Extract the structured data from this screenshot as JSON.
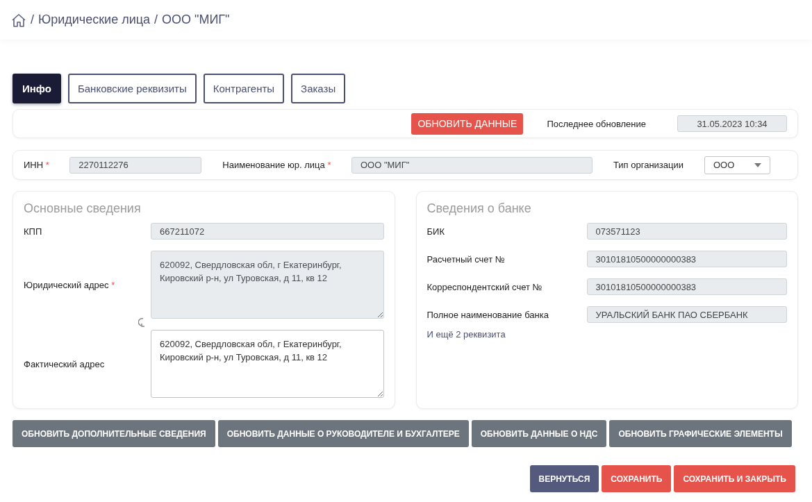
{
  "breadcrumb": {
    "separator": "/",
    "items": [
      "Юридические лица",
      "ООО \"МИГ\""
    ]
  },
  "required_mark": "*",
  "tabs": [
    {
      "label": "Инфо",
      "selected": true
    },
    {
      "label": "Банковские реквизиты",
      "selected": false
    },
    {
      "label": "Контрагенты",
      "selected": false
    },
    {
      "label": "Заказы",
      "selected": false
    }
  ],
  "update_bar": {
    "button": "ОБНОВИТЬ ДАННЫЕ",
    "label": "Последнее обновление",
    "value": "31.05.2023 10:34"
  },
  "org_row": [
    {
      "kind": "input",
      "label": "ИНН",
      "required": true,
      "value": "2270112276"
    },
    {
      "kind": "input",
      "label": "Наименование юр. лица",
      "required": true,
      "value": "ООО \"МИГ\""
    },
    {
      "kind": "select",
      "label": "Тип организации",
      "required": false,
      "value": "ООО"
    }
  ],
  "main_info": {
    "title": "Основные сведения",
    "fields": [
      {
        "kind": "input",
        "label": "КПП",
        "required": false,
        "disabled": true,
        "value": "667211072"
      },
      {
        "kind": "textarea",
        "label": "Юридический адрес",
        "required": true,
        "disabled": true,
        "value": "620092, Свердловская обл, г Екатеринбург, Кировский р-н, ул Туровская, д 11, кв 12"
      },
      {
        "kind": "textarea",
        "label": "Фактический адрес",
        "required": false,
        "disabled": false,
        "value": "620092, Свердловская обл, г Екатеринбург, Кировский р-н, ул Туровская, д 11, кв 12"
      }
    ]
  },
  "bank_info": {
    "title": "Сведения о банке",
    "fields": [
      {
        "kind": "input",
        "label": "БИК",
        "required": false,
        "disabled": true,
        "value": "073571123"
      },
      {
        "kind": "input",
        "label": "Расчетный счет №",
        "required": false,
        "disabled": true,
        "value": "30101810500000000383"
      },
      {
        "kind": "input",
        "label": "Корреспондентский счет №",
        "required": false,
        "disabled": true,
        "value": "30101810500000000383"
      },
      {
        "kind": "input",
        "label": "Полное наименование банка",
        "required": false,
        "disabled": true,
        "value": "УРАЛЬСКИЙ БАНК ПАО СБЕРБАНК"
      }
    ],
    "more_link": "И ещё 2 реквизита"
  },
  "action_buttons": [
    "ОБНОВИТЬ ДОПОЛНИТЕЛЬНЫЕ СВЕДЕНИЯ",
    "ОБНОВИТЬ ДАННЫЕ О РУКОВОДИТЕЛЕ И БУХГАЛТЕРЕ",
    "ОБНОВИТЬ ДАННЫЕ О НДС",
    "ОБНОВИТЬ ГРАФИЧЕСКИЕ ЭЛЕМЕНТЫ"
  ],
  "footer_buttons": [
    {
      "kind": "secondary",
      "label": "ВЕРНУТЬСЯ"
    },
    {
      "kind": "danger",
      "label": "СОХРАНИТЬ"
    },
    {
      "kind": "danger",
      "label": "СОХРАНИТЬ И ЗАКРЫТЬ"
    }
  ]
}
